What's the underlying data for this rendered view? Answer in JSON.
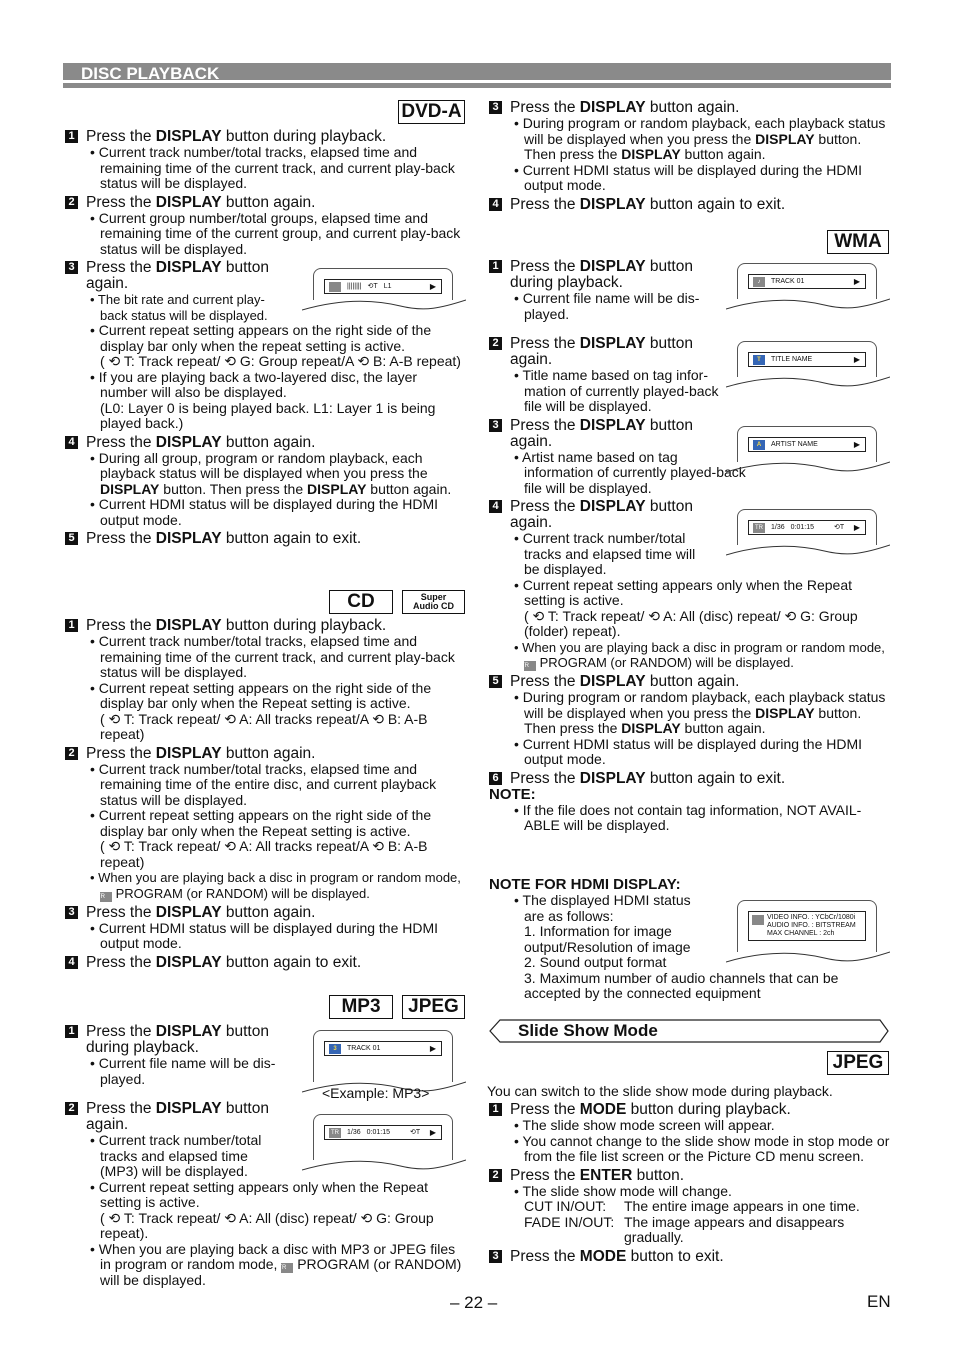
{
  "header": {
    "title": "DISC PLAYBACK"
  },
  "dvda": {
    "tag": "DVD-A",
    "s1": {
      "n": "1",
      "pre": "Press the ",
      "b": "DISPLAY",
      "post": " button during playback.",
      "bul": [
        "• Current track number/total tracks, elapsed time and remaining time of the current track, and current play-back status will be displayed."
      ]
    },
    "s2": {
      "n": "2",
      "pre": "Press the ",
      "b": "DISPLAY",
      "post": " button again.",
      "bul": [
        "• Current group number/total groups, elapsed time and remaining time of the current group, and current play-back status will be displayed."
      ]
    },
    "s3": {
      "n": "3",
      "pre": "Press the ",
      "b": "DISPLAY",
      "post": " button again.",
      "bul0": "• The bit rate and current play-back status will be displayed.",
      "bul1": "• Current repeat setting appears on the right side of the display bar only when the repeat setting is active.",
      "bul1b": "( ⟲ T: Track repeat/ ⟲ G: Group repeat/A ⟲ B: A-B repeat)",
      "bul2": "• If you are playing back a two-layered disc, the layer number will also be displayed.",
      "bul2b": "(L0: Layer 0 is being played back. L1: Layer 1 is being played back.)"
    },
    "screen": {
      "repeat": "⟲T",
      "layer": "L1",
      "arrow": "▶"
    },
    "s4": {
      "n": "4",
      "pre": "Press the ",
      "b": "DISPLAY",
      "post": " button again.",
      "bul1a": "• During all group, program or random playback, each playback status will be displayed when you press the ",
      "bul1b": "DISPLAY",
      "bul1c": " button. Then press the ",
      "bul1d": "DISPLAY",
      "bul1e": " button again.",
      "bul2": "• Current HDMI status will be displayed during the HDMI output mode."
    },
    "s5": {
      "n": "5",
      "pre": "Press the ",
      "b": "DISPLAY",
      "post": " button again to exit."
    }
  },
  "cd": {
    "tag": "CD",
    "tag2a": "Super",
    "tag2b": "Audio CD",
    "s1": {
      "n": "1",
      "pre": "Press the ",
      "b": "DISPLAY",
      "post": " button during playback.",
      "bul1": "• Current track number/total tracks, elapsed time and remaining time of the current track, and current play-back status will be displayed.",
      "bul2": "• Current repeat setting appears on the right side of the display bar only when the Repeat setting is active.",
      "bul2b": "( ⟲ T: Track repeat/ ⟲ A: All tracks repeat/A ⟲ B: A-B repeat)"
    },
    "s2": {
      "n": "2",
      "pre": "Press the ",
      "b": "DISPLAY",
      "post": " button again.",
      "bul1": "• Current track number/total tracks, elapsed time and remaining time of the entire disc, and current playback status will be displayed.",
      "bul2": "• Current repeat setting appears on the right side of the display bar only when the Repeat setting is active.",
      "bul2b": "( ⟲ T: Track repeat/ ⟲ A: All tracks repeat/A ⟲ B: A-B repeat)",
      "bul3": "• When you are playing back a disc in program or random mode,",
      "bul3b": "PROGRAM (or RANDOM) will be displayed."
    },
    "s3": {
      "n": "3",
      "pre": "Press the ",
      "b": "DISPLAY",
      "post": " button again.",
      "bul1": "• Current HDMI status will be displayed during the HDMI output mode."
    },
    "s4": {
      "n": "4",
      "pre": "Press the ",
      "b": "DISPLAY",
      "post": " button again to exit."
    }
  },
  "mp3": {
    "tag1": "MP3",
    "tag2": "JPEG",
    "s1": {
      "n": "1",
      "pre": "Press the ",
      "b": "DISPLAY",
      "post": " button during playback.",
      "bul1": "• Current file name will be dis-played."
    },
    "screen1": {
      "icon": "3",
      "text": "TRACK 01",
      "arrow": "▶"
    },
    "example": "<Example: MP3>",
    "s2": {
      "n": "2",
      "pre": "Press the ",
      "b": "DISPLAY",
      "post": " button again.",
      "bul1": "• Current track number/total tracks and elapsed time (MP3) will be displayed.",
      "bul2": "• Current repeat setting appears only when the Repeat setting is active.",
      "bul2b": "( ⟲ T: Track repeat/ ⟲ A: All (disc) repeat/ ⟲ G: Group repeat).",
      "bul3": "• When you are playing back a disc with MP3 or JPEG files in program or random mode,",
      "bul3b": "PROGRAM (or RANDOM) will be displayed."
    },
    "screen2": {
      "icon": "TR",
      "track": "1/36",
      "time": "0:01:15",
      "repeat": "⟲T",
      "arrow": "▶"
    }
  },
  "right_top": {
    "s3": {
      "n": "3",
      "pre": "Press the ",
      "b": "DISPLAY",
      "post": " button again.",
      "bul1a": "• During program or random playback, each playback status will be displayed when you press the ",
      "bul1b": "DISPLAY",
      "bul1c": " button. Then press the ",
      "bul1d": "DISPLAY",
      "bul1e": " button again.",
      "bul2": "• Current HDMI status will be displayed during the HDMI output mode."
    },
    "s4": {
      "n": "4",
      "pre": "Press the ",
      "b": "DISPLAY",
      "post": " button again to exit."
    }
  },
  "wma": {
    "tag": "WMA",
    "s1": {
      "n": "1",
      "pre": "Press the ",
      "b": "DISPLAY",
      "post": " button during playback.",
      "bul1": "• Current file name will be dis-played."
    },
    "screen1": {
      "icon": "♪",
      "text": "TRACK 01",
      "arrow": "▶"
    },
    "s2": {
      "n": "2",
      "pre": "Press the ",
      "b": "DISPLAY",
      "post": " button again.",
      "bul1": "• Title name based on tag infor-mation of currently played-back file will be displayed."
    },
    "screen2": {
      "icon": "T",
      "text": "TITLE NAME",
      "arrow": "▶"
    },
    "s3": {
      "n": "3",
      "pre": "Press the ",
      "b": "DISPLAY",
      "post": " button again.",
      "bul1": "• Artist name based on tag information of currently played-back file will be displayed."
    },
    "screen3": {
      "icon": "A",
      "text": "ARTIST NAME",
      "arrow": "▶"
    },
    "s4": {
      "n": "4",
      "pre": "Press the ",
      "b": "DISPLAY",
      "post": " button again.",
      "bul1": "• Current track number/total tracks and elapsed time will be displayed.",
      "bul2": "• Current repeat setting appears only when the Repeat setting is active.",
      "bul2b": "( ⟲ T: Track repeat/ ⟲ A: All (disc) repeat/ ⟲ G: Group (folder) repeat).",
      "bul3": "• When you are playing back a disc in program or random mode,",
      "bul3b": "PROGRAM (or RANDOM) will be displayed."
    },
    "screen4": {
      "icon": "TR",
      "track": "1/36",
      "time": "0:01:15",
      "repeat": "⟲T",
      "arrow": "▶"
    },
    "s5": {
      "n": "5",
      "pre": "Press the ",
      "b": "DISPLAY",
      "post": " button again.",
      "bul1a": "• During program or random playback, each playback status will be displayed when you press the ",
      "bul1b": "DISPLAY",
      "bul1c": " button. Then press the ",
      "bul1d": "DISPLAY",
      "bul1e": " button again.",
      "bul2": "• Current HDMI status will be displayed during the HDMI output mode."
    },
    "s6": {
      "n": "6",
      "pre": "Press the ",
      "b": "DISPLAY",
      "post": " button again to exit."
    },
    "note_title": "NOTE:",
    "note": "• If the file does not contain tag information, NOT AVAIL-ABLE will be displayed."
  },
  "hdmi": {
    "title": "NOTE FOR HDMI DISPLAY:",
    "bul1": "• The displayed HDMI status are as follows:",
    "items": [
      "1. Information for image output/Resolution of image",
      "2. Sound output format",
      "3. Maximum number of audio channels that can be accepted by the connected equipment"
    ],
    "screen": {
      "rows": [
        "VIDEO INFO.   :  YCbCr/1080i",
        "AUDIO INFO.   :  BITSTREAM",
        "MAX CHANNEL :  2ch"
      ]
    }
  },
  "slideshow": {
    "title": "Slide Show Mode",
    "tag": "JPEG",
    "intro": "You can switch to the slide show mode during playback.",
    "s1": {
      "n": "1",
      "pre": "Press the ",
      "b": "MODE",
      "post": " button during playback.",
      "bul1": "• The slide show mode screen will appear.",
      "bul2": "• You cannot change to the slide show mode in stop mode or from the file list screen or the Picture CD menu screen."
    },
    "s2": {
      "n": "2",
      "pre": "Press the ",
      "b": "ENTER",
      "post": " button.",
      "bul1": "• The slide show mode will change.",
      "cut_k": "CUT IN/OUT:",
      "cut_v": "The entire image appears in one time.",
      "fade_k": "FADE IN/OUT:",
      "fade_v": "The image appears and disappears gradually."
    },
    "s3": {
      "n": "3",
      "pre": "Press the ",
      "b": "MODE",
      "post": " button to exit."
    }
  },
  "footer": {
    "page": "– 22 –",
    "lang": "EN"
  }
}
